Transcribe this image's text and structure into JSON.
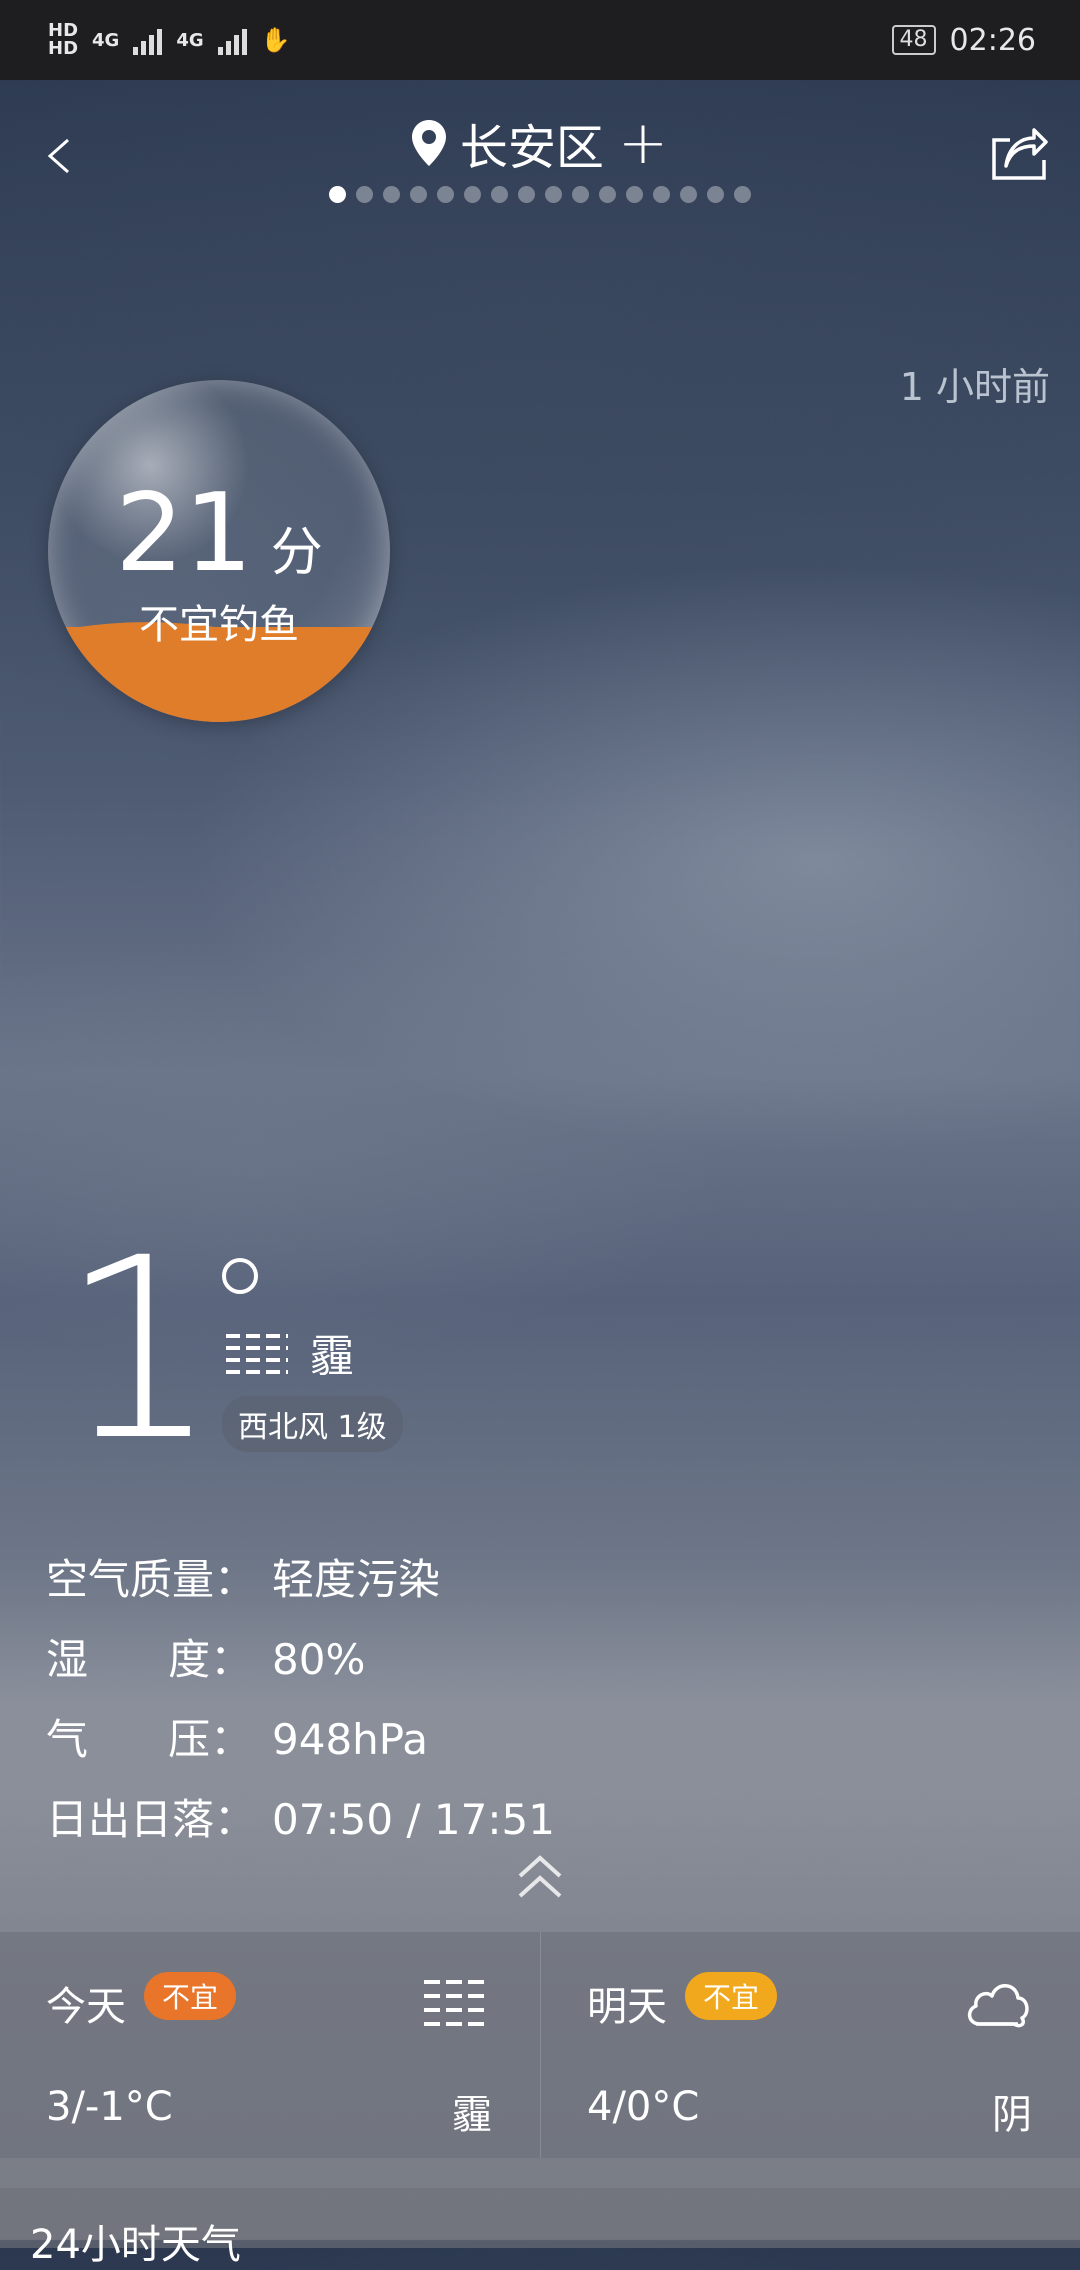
{
  "status_bar": {
    "sim1": "HD",
    "sim2": "HD",
    "network1": "4G",
    "network2": "4G",
    "battery": "48",
    "time": "02:26"
  },
  "header": {
    "location": "长安区",
    "add_symbol": "+",
    "page_count": 16,
    "active_page": 0
  },
  "updated": "1 小时前",
  "fishing": {
    "score": "21",
    "unit": "分",
    "label": "不宜钓鱼",
    "accent": "#e07d2a"
  },
  "current": {
    "temperature": "1",
    "condition": "霾",
    "wind": "西北风 1级"
  },
  "details": [
    {
      "key": "空气质量：",
      "value": "轻度污染"
    },
    {
      "key": "湿      度：",
      "value": "80%"
    },
    {
      "key": "气      压：",
      "value": "948hPa"
    },
    {
      "key": "日出日落：",
      "value": "07:50 / 17:51"
    }
  ],
  "forecast": [
    {
      "day": "今天",
      "badge": "不宜",
      "badge_color": "#e8752a",
      "temp": "3/-1°C",
      "condition": "霾",
      "icon": "haze-icon"
    },
    {
      "day": "明天",
      "badge": "不宜",
      "badge_color": "#f2a81c",
      "temp": "4/0°C",
      "condition": "阴",
      "icon": "cloud-icon"
    }
  ],
  "hourly": {
    "title": "24小时天气"
  }
}
